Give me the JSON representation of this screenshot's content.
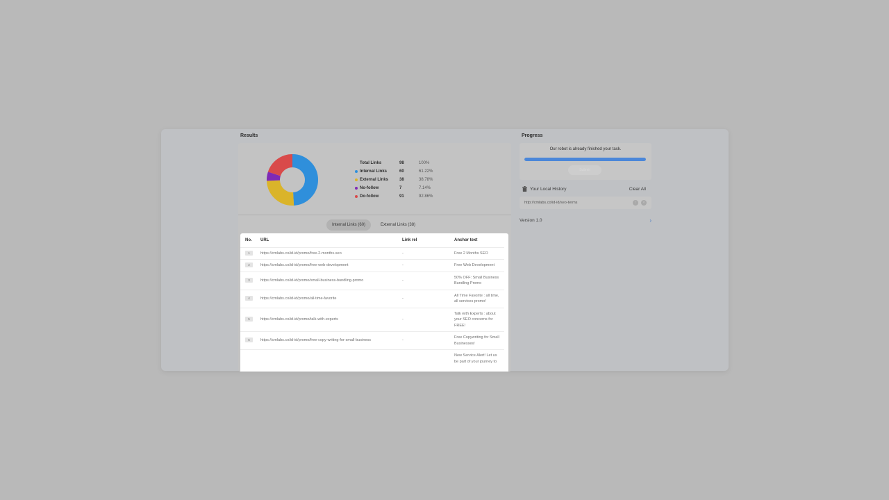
{
  "results": {
    "title": "Results",
    "stats": [
      {
        "label": "Total Links",
        "count": "98",
        "percent": "100%",
        "color": ""
      },
      {
        "label": "Internal Links",
        "count": "60",
        "percent": "61.22%",
        "color": "#2f8fdb"
      },
      {
        "label": "External Links",
        "count": "38",
        "percent": "38.78%",
        "color": "#dab42a"
      },
      {
        "label": "No-follow",
        "count": "7",
        "percent": "7.14%",
        "color": "#7f2ab5"
      },
      {
        "label": "Do-follow",
        "count": "91",
        "percent": "92.86%",
        "color": "#d94a4a"
      }
    ],
    "tabs": {
      "internal": "Internal Links (60)",
      "external": "External Links (38)"
    },
    "table": {
      "headers": {
        "no": "No.",
        "url": "URL",
        "rel": "Link rel",
        "anchor": "Anchor text"
      },
      "rows": [
        {
          "no": "1",
          "url": "https://cmlabs.co/id-id/promo/free-2-months-seo",
          "rel": "-",
          "anchor": "Free 2 Months SEO"
        },
        {
          "no": "2",
          "url": "https://cmlabs.co/id-id/promo/free-web-development",
          "rel": "-",
          "anchor": "Free Web Development"
        },
        {
          "no": "3",
          "url": "https://cmlabs.co/id-id/promo/small-business-bundling-promo",
          "rel": "-",
          "anchor": "50% OFF: Small Business Bundling Promo"
        },
        {
          "no": "4",
          "url": "https://cmlabs.co/id-id/promo/all-time-favorite",
          "rel": "-",
          "anchor": "All Time Favorite : all time, all services promo!"
        },
        {
          "no": "5",
          "url": "https://cmlabs.co/id-id/promo/talk-with-experts",
          "rel": "-",
          "anchor": "Talk with Experts : about your SEO concerns for FREE!"
        },
        {
          "no": "6",
          "url": "https://cmlabs.co/id-id/promo/free-copy-writing-for-small-business",
          "rel": "-",
          "anchor": "Free Copywriting for Small Businesses!"
        },
        {
          "no": "",
          "url": "",
          "rel": "",
          "anchor": "New Service Alert! Let us be part of your journey to"
        }
      ]
    }
  },
  "progress": {
    "title": "Progress",
    "message": "Our robot is already finished your task.",
    "value": 1.0,
    "button": "Submit"
  },
  "history": {
    "title": "Your Local History",
    "clear": "Clear All",
    "items": [
      {
        "url": "http://cmlabs.co/id-id/seo-terms"
      }
    ]
  },
  "version": "Version 1.0",
  "colors": {
    "internal": "#2f8fdb",
    "external": "#dab42a",
    "nofollow": "#7f2ab5",
    "dofollow": "#d94a4a",
    "progress": "#4b87d9"
  }
}
